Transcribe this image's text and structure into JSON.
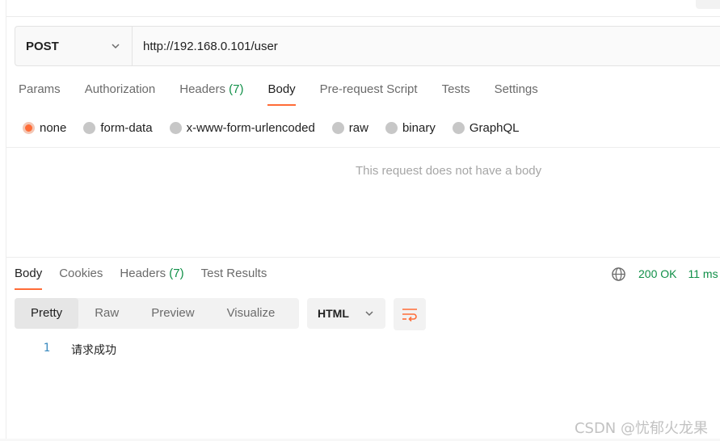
{
  "request": {
    "method": "POST",
    "url": "http://192.168.0.101/user",
    "tabs": [
      {
        "label": "Params",
        "count": ""
      },
      {
        "label": "Authorization",
        "count": ""
      },
      {
        "label": "Headers",
        "count": "(7)"
      },
      {
        "label": "Body",
        "count": ""
      },
      {
        "label": "Pre-request Script",
        "count": ""
      },
      {
        "label": "Tests",
        "count": ""
      },
      {
        "label": "Settings",
        "count": ""
      }
    ],
    "active_tab": "Body",
    "body_types": [
      "none",
      "form-data",
      "x-www-form-urlencoded",
      "raw",
      "binary",
      "GraphQL"
    ],
    "selected_body_type": "none",
    "empty_message": "This request does not have a body"
  },
  "response": {
    "tabs": [
      {
        "label": "Body",
        "count": ""
      },
      {
        "label": "Cookies",
        "count": ""
      },
      {
        "label": "Headers",
        "count": "(7)"
      },
      {
        "label": "Test Results",
        "count": ""
      }
    ],
    "active_tab": "Body",
    "status": "200 OK",
    "time": "11 ms",
    "view_modes": [
      "Pretty",
      "Raw",
      "Preview",
      "Visualize"
    ],
    "active_view_mode": "Pretty",
    "language": "HTML",
    "lines": [
      {
        "number": "1",
        "text": "请求成功"
      }
    ]
  },
  "watermark": "CSDN @忧郁火龙果",
  "colors": {
    "accent": "#ff6c37",
    "success": "#0f8f47",
    "line_number": "#3a8abf"
  },
  "icons": [
    "chevron-down-icon",
    "globe-icon",
    "wrap-lines-icon"
  ]
}
